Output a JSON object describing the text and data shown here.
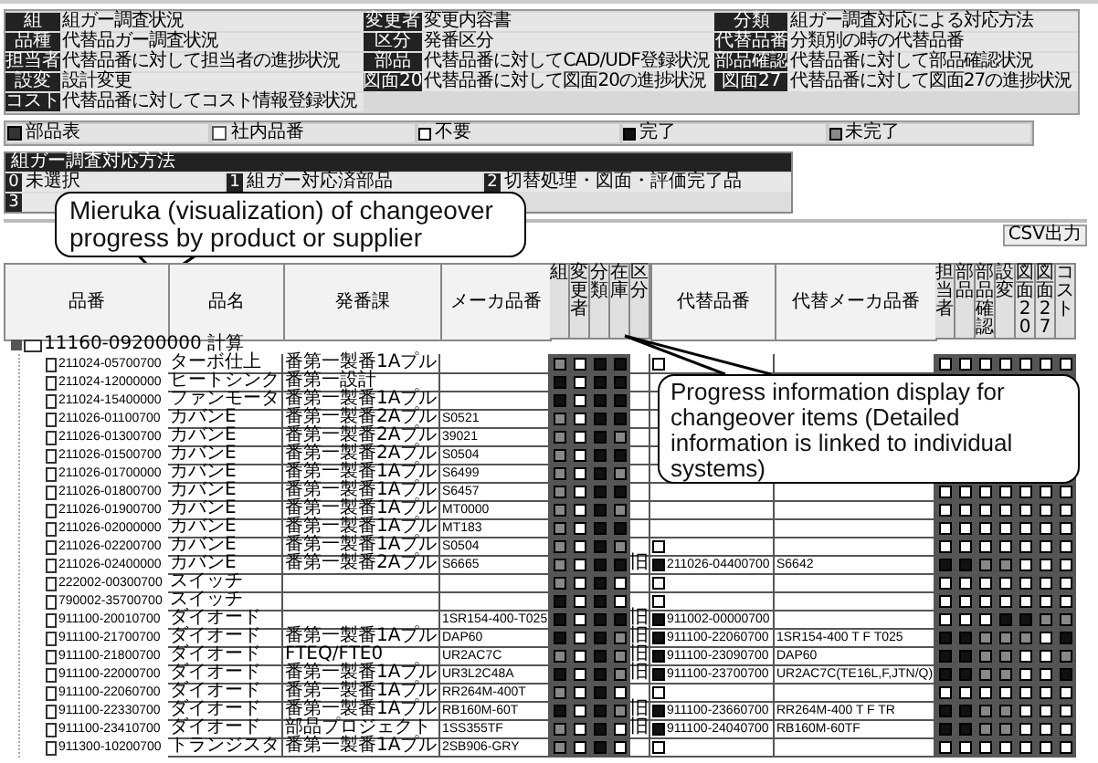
{
  "legend": [
    {
      "label": "組",
      "value": "組ガー調査状況"
    },
    {
      "label": "変更者",
      "value": "変更内容書"
    },
    {
      "label": "分類",
      "value": "組ガー調査対応による対応方法"
    },
    {
      "label": "品種",
      "value": "代替品ガー調査状況"
    },
    {
      "label": "区分",
      "value": "発番区分"
    },
    {
      "label": "代替品番",
      "value": "分類別の時の代替品番"
    },
    {
      "label": "担当者",
      "value": "代替品番に対して担当者の進捗状況"
    },
    {
      "label": "部品",
      "value": "代替品番に対してCAD/UDF登録状況"
    },
    {
      "label": "部品確認",
      "value": "代替品番に対して部品確認状況"
    },
    {
      "label": "設変",
      "value": "設計変更"
    },
    {
      "label": "図面20",
      "value": "代替品番に対して図面20の進捗状況"
    },
    {
      "label": "図面27",
      "value": "代替品番に対して図面27の進捗状況"
    },
    {
      "label": "コスト",
      "value": "代替品番に対してコスト情報登録状況"
    }
  ],
  "status_legend": [
    {
      "kind": "parts",
      "label": "部品表"
    },
    {
      "kind": "internal",
      "label": "社内品番"
    },
    {
      "kind": "none",
      "label": "不要"
    },
    {
      "kind": "done",
      "label": "完了"
    },
    {
      "kind": "pending",
      "label": "未完了"
    }
  ],
  "method_box": {
    "title": "組ガー調査対応方法",
    "options": [
      {
        "number": "0",
        "label": "未選択"
      },
      {
        "number": "1",
        "label": "組ガー対応済部品"
      },
      {
        "number": "2",
        "label": "切替処理・図面・評価完了品"
      },
      {
        "number": "3"
      }
    ]
  },
  "csv_button": "CSV出力",
  "table": {
    "columns": [
      {
        "label": "品番",
        "kind": "text"
      },
      {
        "label": "品名",
        "kind": "text"
      },
      {
        "label": "発番課",
        "kind": "text"
      },
      {
        "label": "メーカ品番",
        "kind": "text"
      },
      {
        "label": "組",
        "kind": "status"
      },
      {
        "label": "変更者",
        "kind": "status"
      },
      {
        "label": "分類",
        "kind": "status"
      },
      {
        "label": "在庫",
        "kind": "status"
      },
      {
        "label": "区分",
        "kind": "narrow"
      },
      {
        "label": "代替品番",
        "kind": "text"
      },
      {
        "label": "代替メーカ品番",
        "kind": "text"
      },
      {
        "label": "担当者",
        "kind": "status"
      },
      {
        "label": "部品",
        "kind": "status"
      },
      {
        "label": "部品確認",
        "kind": "status"
      },
      {
        "label": "設変",
        "kind": "status"
      },
      {
        "label": "図面20",
        "kind": "status"
      },
      {
        "label": "図面27",
        "kind": "status"
      },
      {
        "label": "コスト",
        "kind": "status"
      }
    ],
    "root": {
      "part_no": "11160-09200000 計算",
      "children": [
        {
          "part_no": "211024-05700700",
          "name": "ターボ仕上",
          "dept": "番第一製番1Aプル",
          "left": [
            {
              "kind": "pending"
            },
            {
              "kind": "none"
            },
            {
              "kind": "done"
            },
            {
              "kind": "done"
            }
          ],
          "alt_done": false,
          "right": [
            {
              "kind": "none"
            },
            {
              "kind": "none"
            },
            {
              "kind": "none"
            },
            {
              "kind": "none"
            },
            {
              "kind": "none"
            },
            {
              "kind": "none"
            },
            {
              "kind": "none"
            }
          ]
        },
        {
          "part_no": "211024-12000000",
          "name": "ヒートシンク",
          "dept": "番第一設計",
          "left": [
            {
              "kind": "done"
            },
            {
              "kind": "none"
            },
            {
              "kind": "done"
            },
            {
              "kind": "done"
            }
          ]
        },
        {
          "part_no": "211024-15400000",
          "name": "ファンモータ",
          "dept": "番第一製番1Aプル",
          "left": [
            {
              "kind": "done"
            },
            {
              "kind": "none"
            },
            {
              "kind": "done"
            },
            {
              "kind": "done"
            }
          ]
        },
        {
          "part_no": "211026-01100700",
          "name": "カバンE",
          "dept": "番第一製番2Aプル",
          "maker_no": "S0521",
          "left": [
            {
              "kind": "pending"
            },
            {
              "kind": "none"
            },
            {
              "kind": "done"
            },
            {
              "kind": "done"
            }
          ]
        },
        {
          "part_no": "211026-01300700",
          "name": "カバンE",
          "dept": "番第一製番2Aプル",
          "maker_no": "39021",
          "left": [
            {
              "kind": "pending"
            },
            {
              "kind": "none"
            },
            {
              "kind": "done"
            },
            {
              "kind": "pending"
            }
          ]
        },
        {
          "part_no": "211026-01500700",
          "name": "カバンE",
          "dept": "番第一製番2Aプル",
          "maker_no": "S0504",
          "left": [
            {
              "kind": "pending"
            },
            {
              "kind": "none"
            },
            {
              "kind": "done"
            },
            {
              "kind": "done"
            }
          ]
        },
        {
          "part_no": "211026-01700000",
          "name": "カバンE",
          "dept": "番第一製番1Aプル",
          "maker_no": "S6499",
          "left": [
            {
              "kind": "pending"
            },
            {
              "kind": "none"
            },
            {
              "kind": "done"
            },
            {
              "kind": "pending"
            }
          ]
        },
        {
          "part_no": "211026-01800700",
          "name": "カバンE",
          "dept": "番第一製番1Aプル",
          "maker_no": "S6457",
          "left": [
            {
              "kind": "pending"
            },
            {
              "kind": "none"
            },
            {
              "kind": "done"
            },
            {
              "kind": "done"
            }
          ],
          "right": [
            {
              "kind": "none"
            },
            {
              "kind": "none"
            },
            {
              "kind": "none"
            },
            {
              "kind": "none"
            },
            {
              "kind": "none"
            },
            {
              "kind": "none"
            },
            {
              "kind": "none"
            }
          ]
        },
        {
          "part_no": "211026-01900700",
          "name": "カバンE",
          "dept": "番第一製番1Aプル",
          "maker_no": "MT0000",
          "left": [
            {
              "kind": "pending"
            },
            {
              "kind": "none"
            },
            {
              "kind": "done"
            },
            {
              "kind": "pending"
            }
          ],
          "right": [
            {
              "kind": "none"
            },
            {
              "kind": "none"
            },
            {
              "kind": "none"
            },
            {
              "kind": "none"
            },
            {
              "kind": "none"
            },
            {
              "kind": "none"
            },
            {
              "kind": "none"
            }
          ]
        },
        {
          "part_no": "211026-02000000",
          "name": "カバンE",
          "dept": "番第一製番1Aプル",
          "maker_no": "MT183",
          "left": [
            {
              "kind": "pending"
            },
            {
              "kind": "none"
            },
            {
              "kind": "done"
            },
            {
              "kind": "done"
            }
          ],
          "right": [
            {
              "kind": "none"
            },
            {
              "kind": "none"
            },
            {
              "kind": "none"
            },
            {
              "kind": "none"
            },
            {
              "kind": "none"
            },
            {
              "kind": "none"
            },
            {
              "kind": "none"
            }
          ]
        },
        {
          "part_no": "211026-02200700",
          "name": "カバンE",
          "dept": "番第一製番1Aプル",
          "maker_no": "S0504",
          "left": [
            {
              "kind": "pending"
            },
            {
              "kind": "none"
            },
            {
              "kind": "done"
            },
            {
              "kind": "pending"
            }
          ],
          "alt_done": false,
          "right": [
            {
              "kind": "none"
            },
            {
              "kind": "none"
            },
            {
              "kind": "none"
            },
            {
              "kind": "none"
            },
            {
              "kind": "none"
            },
            {
              "kind": "none"
            },
            {
              "kind": "none"
            }
          ]
        },
        {
          "part_no": "211026-02400000",
          "name": "カバンE",
          "dept": "番第一製番2Aプル",
          "maker_no": "S6665",
          "left": [
            {
              "kind": "pending"
            },
            {
              "kind": "none"
            },
            {
              "kind": "done"
            },
            {
              "kind": "done"
            }
          ],
          "category": "旧",
          "alt_done": true,
          "alt_no": "211026-04400700",
          "alt_maker_no": "S6642",
          "right": [
            {
              "kind": "done"
            },
            {
              "kind": "done"
            },
            {
              "kind": "pending"
            },
            {
              "kind": "pending"
            },
            {
              "kind": "none"
            },
            {
              "kind": "none"
            },
            {
              "kind": "none"
            }
          ]
        },
        {
          "part_no": "222002-00300700",
          "name": "スイッチ",
          "left": [
            {
              "kind": "pending"
            },
            {
              "kind": "none"
            },
            {
              "kind": "done"
            },
            {
              "kind": "none"
            }
          ],
          "alt_done": false,
          "right": [
            {
              "kind": "none"
            },
            {
              "kind": "none"
            },
            {
              "kind": "none"
            },
            {
              "kind": "none"
            },
            {
              "kind": "none"
            },
            {
              "kind": "none"
            },
            {
              "kind": "none"
            }
          ]
        },
        {
          "part_no": "790002-35700700",
          "name": "スイッチ",
          "left": [
            {
              "kind": "done"
            },
            {
              "kind": "none"
            },
            {
              "kind": "done"
            },
            {
              "kind": "none"
            }
          ],
          "alt_done": false,
          "right": [
            {
              "kind": "none"
            },
            {
              "kind": "none"
            },
            {
              "kind": "none"
            },
            {
              "kind": "none"
            },
            {
              "kind": "none"
            },
            {
              "kind": "none"
            },
            {
              "kind": "none"
            }
          ]
        },
        {
          "part_no": "911100-20010700",
          "name": "ダイオード",
          "maker_no": "1SR154-400-T025",
          "left": [
            {
              "kind": "done"
            },
            {
              "kind": "none"
            },
            {
              "kind": "done"
            },
            {
              "kind": "done"
            }
          ],
          "category": "旧",
          "alt_done": true,
          "alt_no": "911002-00000700",
          "right": [
            {
              "kind": "none"
            },
            {
              "kind": "none"
            },
            {
              "kind": "none"
            },
            {
              "kind": "done"
            },
            {
              "kind": "done"
            },
            {
              "kind": "pending"
            },
            {
              "kind": "pending"
            }
          ]
        },
        {
          "part_no": "911100-21700700",
          "name": "ダイオード",
          "dept": "番第一製番1Aプル",
          "maker_no": "DAP60",
          "left": [
            {
              "kind": "done"
            },
            {
              "kind": "none"
            },
            {
              "kind": "done"
            },
            {
              "kind": "pending"
            }
          ],
          "category": "旧",
          "alt_done": true,
          "alt_no": "911100-22060700",
          "alt_maker_no": "1SR154-400 T F T025",
          "right": [
            {
              "kind": "done"
            },
            {
              "kind": "done"
            },
            {
              "kind": "pending"
            },
            {
              "kind": "pending"
            },
            {
              "kind": "pending"
            },
            {
              "kind": "none"
            },
            {
              "kind": "done"
            }
          ]
        },
        {
          "part_no": "911100-21800700",
          "name": "ダイオード",
          "dept": "FTEQ/FTE0",
          "maker_no": "UR2AC7C",
          "left": [
            {
              "kind": "pending"
            },
            {
              "kind": "none"
            },
            {
              "kind": "done"
            },
            {
              "kind": "pending"
            }
          ],
          "category": "旧",
          "alt_done": true,
          "alt_no": "911100-23090700",
          "alt_maker_no": "DAP60",
          "right": [
            {
              "kind": "done"
            },
            {
              "kind": "done"
            },
            {
              "kind": "pending"
            },
            {
              "kind": "pending"
            },
            {
              "kind": "none"
            },
            {
              "kind": "none"
            },
            {
              "kind": "pending"
            }
          ]
        },
        {
          "part_no": "911100-22000700",
          "name": "ダイオード",
          "dept": "番第一製番1Aプル",
          "maker_no": "UR3L2C48A",
          "left": [
            {
              "kind": "done"
            },
            {
              "kind": "none"
            },
            {
              "kind": "done"
            },
            {
              "kind": "pending"
            }
          ],
          "category": "旧",
          "alt_done": true,
          "alt_no": "911100-23700700",
          "alt_maker_no": "UR2AC7C(TE16L,F,JTN/Q)",
          "right": [
            {
              "kind": "done"
            },
            {
              "kind": "done"
            },
            {
              "kind": "pending"
            },
            {
              "kind": "pending"
            },
            {
              "kind": "none"
            },
            {
              "kind": "none"
            },
            {
              "kind": "done"
            }
          ]
        },
        {
          "part_no": "911100-22060700",
          "name": "ダイオード",
          "dept": "番第一製番1Aプル",
          "maker_no": "RR264M-400T",
          "left": [
            {
              "kind": "pending"
            },
            {
              "kind": "none"
            },
            {
              "kind": "done"
            },
            {
              "kind": "none"
            }
          ],
          "alt_done": false,
          "right": [
            {
              "kind": "none"
            },
            {
              "kind": "none"
            },
            {
              "kind": "none"
            },
            {
              "kind": "none"
            },
            {
              "kind": "none"
            },
            {
              "kind": "none"
            },
            {
              "kind": "none"
            }
          ]
        },
        {
          "part_no": "911100-22330700",
          "name": "ダイオード",
          "dept": "番第一製番1Aプル",
          "maker_no": "RB160M-60T",
          "left": [
            {
              "kind": "done"
            },
            {
              "kind": "none"
            },
            {
              "kind": "done"
            },
            {
              "kind": "pending"
            }
          ],
          "category": "旧",
          "alt_done": true,
          "alt_no": "911100-23660700",
          "alt_maker_no": "RR264M-400 T F TR",
          "right": [
            {
              "kind": "done"
            },
            {
              "kind": "done"
            },
            {
              "kind": "pending"
            },
            {
              "kind": "pending"
            },
            {
              "kind": "none"
            },
            {
              "kind": "none"
            },
            {
              "kind": "none"
            }
          ]
        },
        {
          "part_no": "911100-23410700",
          "name": "ダイオード",
          "dept": "部品プロジェクト",
          "maker_no": "1SS355TF",
          "left": [
            {
              "kind": "pending"
            },
            {
              "kind": "none"
            },
            {
              "kind": "done"
            },
            {
              "kind": "none"
            }
          ],
          "category": "旧",
          "alt_done": true,
          "alt_no": "911100-24040700",
          "alt_maker_no": "RB160M-60TF",
          "right": [
            {
              "kind": "done"
            },
            {
              "kind": "done"
            },
            {
              "kind": "pending"
            },
            {
              "kind": "pending"
            },
            {
              "kind": "none"
            },
            {
              "kind": "none"
            },
            {
              "kind": "none"
            }
          ]
        },
        {
          "part_no": "911300-10200700",
          "name": "トランジスタ",
          "dept": "番第一製番1Aプル",
          "maker_no": "2SB906-GRY",
          "left": [
            {
              "kind": "pending"
            },
            {
              "kind": "none"
            },
            {
              "kind": "done"
            },
            {
              "kind": "none"
            }
          ],
          "alt_done": false,
          "right": [
            {
              "kind": "none"
            },
            {
              "kind": "none"
            },
            {
              "kind": "none"
            },
            {
              "kind": "none"
            },
            {
              "kind": "none"
            },
            {
              "kind": "none"
            },
            {
              "kind": "none"
            }
          ]
        }
      ]
    }
  },
  "callouts": [
    {
      "text": "Mieruka (visualization) of changeover progress by product or supplier"
    },
    {
      "text": "Progress information display for changeover items (Detailed information is linked to individual systems)"
    }
  ]
}
